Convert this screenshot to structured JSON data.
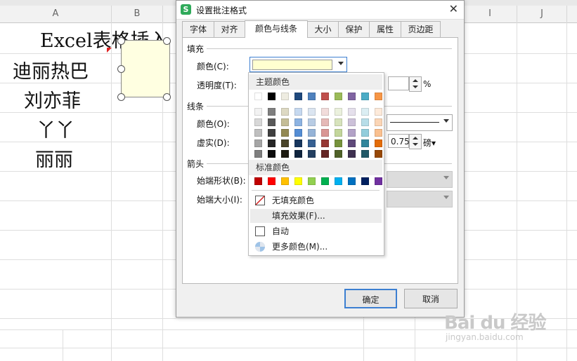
{
  "sheet": {
    "columns": [
      "A",
      "B",
      "",
      "",
      "",
      "",
      "",
      "",
      "",
      "I",
      "J"
    ],
    "cells": [
      "Excel表格插入",
      "迪丽热巴",
      "刘亦菲",
      "丫丫",
      "丽丽"
    ]
  },
  "dialog": {
    "title": "设置批注格式",
    "close": "✕",
    "tabs": [
      "字体",
      "对齐",
      "颜色与线条",
      "大小",
      "保护",
      "属性",
      "页边距"
    ],
    "fill": {
      "section": "填充",
      "color_label": "颜色(C):",
      "transparency_label": "透明度(T):",
      "percent": "%"
    },
    "line": {
      "section": "线条",
      "color_label": "颜色(O):",
      "dash_label": "虚实(D):",
      "weight_value": "0.75",
      "weight_unit": "磅▾"
    },
    "arrow": {
      "section": "箭头",
      "start_shape_label": "始端形状(B):",
      "start_size_label": "始端大小(I):"
    },
    "ok": "确定",
    "cancel": "取消"
  },
  "palette": {
    "theme_title": "主题颜色",
    "standard_title": "标准颜色",
    "no_fill": "无填充颜色",
    "fill_effects": "填充效果(F)...",
    "auto": "自动",
    "more_colors": "更多颜色(M)..."
  },
  "colors": {
    "selected_fill": "#ffffd0",
    "accent": "#3c7fd1",
    "theme_top": [
      "#ffffff",
      "#000000",
      "#eeece1",
      "#1f497d",
      "#4f81bd",
      "#c0504d",
      "#9bbb59",
      "#8064a2",
      "#4bacc6",
      "#f79646"
    ],
    "theme_shades": [
      [
        "#f2f2f2",
        "#7f7f7f",
        "#ddd9c3",
        "#c6d9f0",
        "#dbe5f1",
        "#f2dcdb",
        "#ebf1dd",
        "#e5e0ec",
        "#dbeef3",
        "#fdeada"
      ],
      [
        "#d8d8d8",
        "#595959",
        "#c4bd97",
        "#8db3e2",
        "#b8cce4",
        "#e5b9b7",
        "#d7e3bc",
        "#ccc1d9",
        "#b7dde8",
        "#fbd5b5"
      ],
      [
        "#bfbfbf",
        "#3f3f3f",
        "#938953",
        "#548dd4",
        "#95b3d7",
        "#d99694",
        "#c3d69b",
        "#b2a2c7",
        "#92cddc",
        "#fac08f"
      ],
      [
        "#a5a5a5",
        "#262626",
        "#494429",
        "#17365d",
        "#366092",
        "#953734",
        "#76923c",
        "#5f497a",
        "#31859b",
        "#e36c09"
      ],
      [
        "#7f7f7f",
        "#0c0c0c",
        "#1d1b10",
        "#0f243e",
        "#244061",
        "#632423",
        "#4f6128",
        "#3f3151",
        "#205867",
        "#974806"
      ]
    ],
    "standard": [
      "#c00000",
      "#ff0000",
      "#ffc000",
      "#ffff00",
      "#92d050",
      "#00b050",
      "#00b0f0",
      "#0070c0",
      "#002060",
      "#7030a0"
    ]
  },
  "watermark": {
    "main": "Bai du 经验",
    "sub": "jingyan.baidu.com"
  }
}
